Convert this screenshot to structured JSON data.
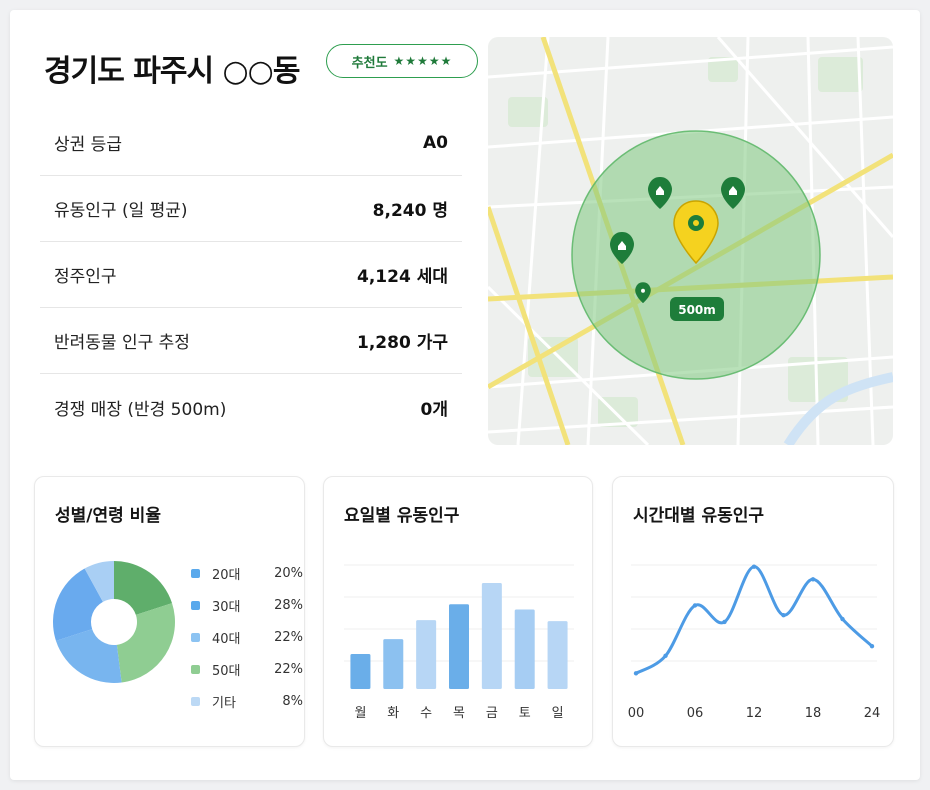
{
  "header": {
    "title": "경기도 파주시 ○○동",
    "badge_label": "추천도",
    "badge_stars": "★★★★★"
  },
  "stats": [
    {
      "label": "상권 등급",
      "value": "A0"
    },
    {
      "label": "유동인구 (일 평균)",
      "value": "8,240 명"
    },
    {
      "label": "정주인구",
      "value": "4,124 세대"
    },
    {
      "label": "반려동물 인구 추정",
      "value": "1,280 가구"
    },
    {
      "label": "경쟁 매장 (반경 500m)",
      "value": "0개"
    }
  ],
  "map": {
    "radius_label": "500m",
    "radius_color": "#7fc97f",
    "main_pin_color": "#f5d21f",
    "store_pin_color": "#1e7d3a",
    "store_pin_count": 4
  },
  "chart_data": [
    {
      "type": "pie",
      "title": "성별/연령 비율",
      "categories": [
        "20대",
        "30대",
        "40대",
        "50대",
        "기타"
      ],
      "values": [
        20,
        28,
        22,
        22,
        8
      ],
      "value_labels": [
        "20%",
        "28%",
        "22%",
        "22%",
        "8%"
      ],
      "colors": [
        "#5aa9ec",
        "#5aa9ec",
        "#8cc3f2",
        "#8fcd92",
        "#bcd9f5"
      ],
      "slice_colors": [
        "#5fae6b",
        "#8fcd92",
        "#78b5ef",
        "#69aaee",
        "#a9cff4"
      ],
      "legend": "right"
    },
    {
      "type": "bar",
      "title": "요일별 유동인구",
      "categories": [
        "월",
        "화",
        "수",
        "목",
        "금",
        "토",
        "일"
      ],
      "values": [
        33,
        47,
        65,
        80,
        100,
        75,
        64
      ],
      "colors": [
        "#6aaee9",
        "#8cc1f0",
        "#b7d6f5",
        "#6aaee9",
        "#b7d6f5",
        "#a6cdf3",
        "#b7d6f5"
      ],
      "ylim": [
        0,
        100
      ],
      "grid": true
    },
    {
      "type": "line",
      "title": "시간대별 유동인구",
      "x": [
        0,
        3,
        6,
        9,
        12,
        15,
        18,
        21,
        24
      ],
      "x_tick_labels": [
        "00",
        "06",
        "12",
        "18",
        "24"
      ],
      "x_ticks": [
        0,
        6,
        12,
        18,
        24
      ],
      "values": [
        10,
        28,
        80,
        63,
        120,
        70,
        107,
        66,
        38
      ],
      "ylim": [
        0,
        130
      ],
      "color": "#4d9be5",
      "grid": true
    }
  ]
}
